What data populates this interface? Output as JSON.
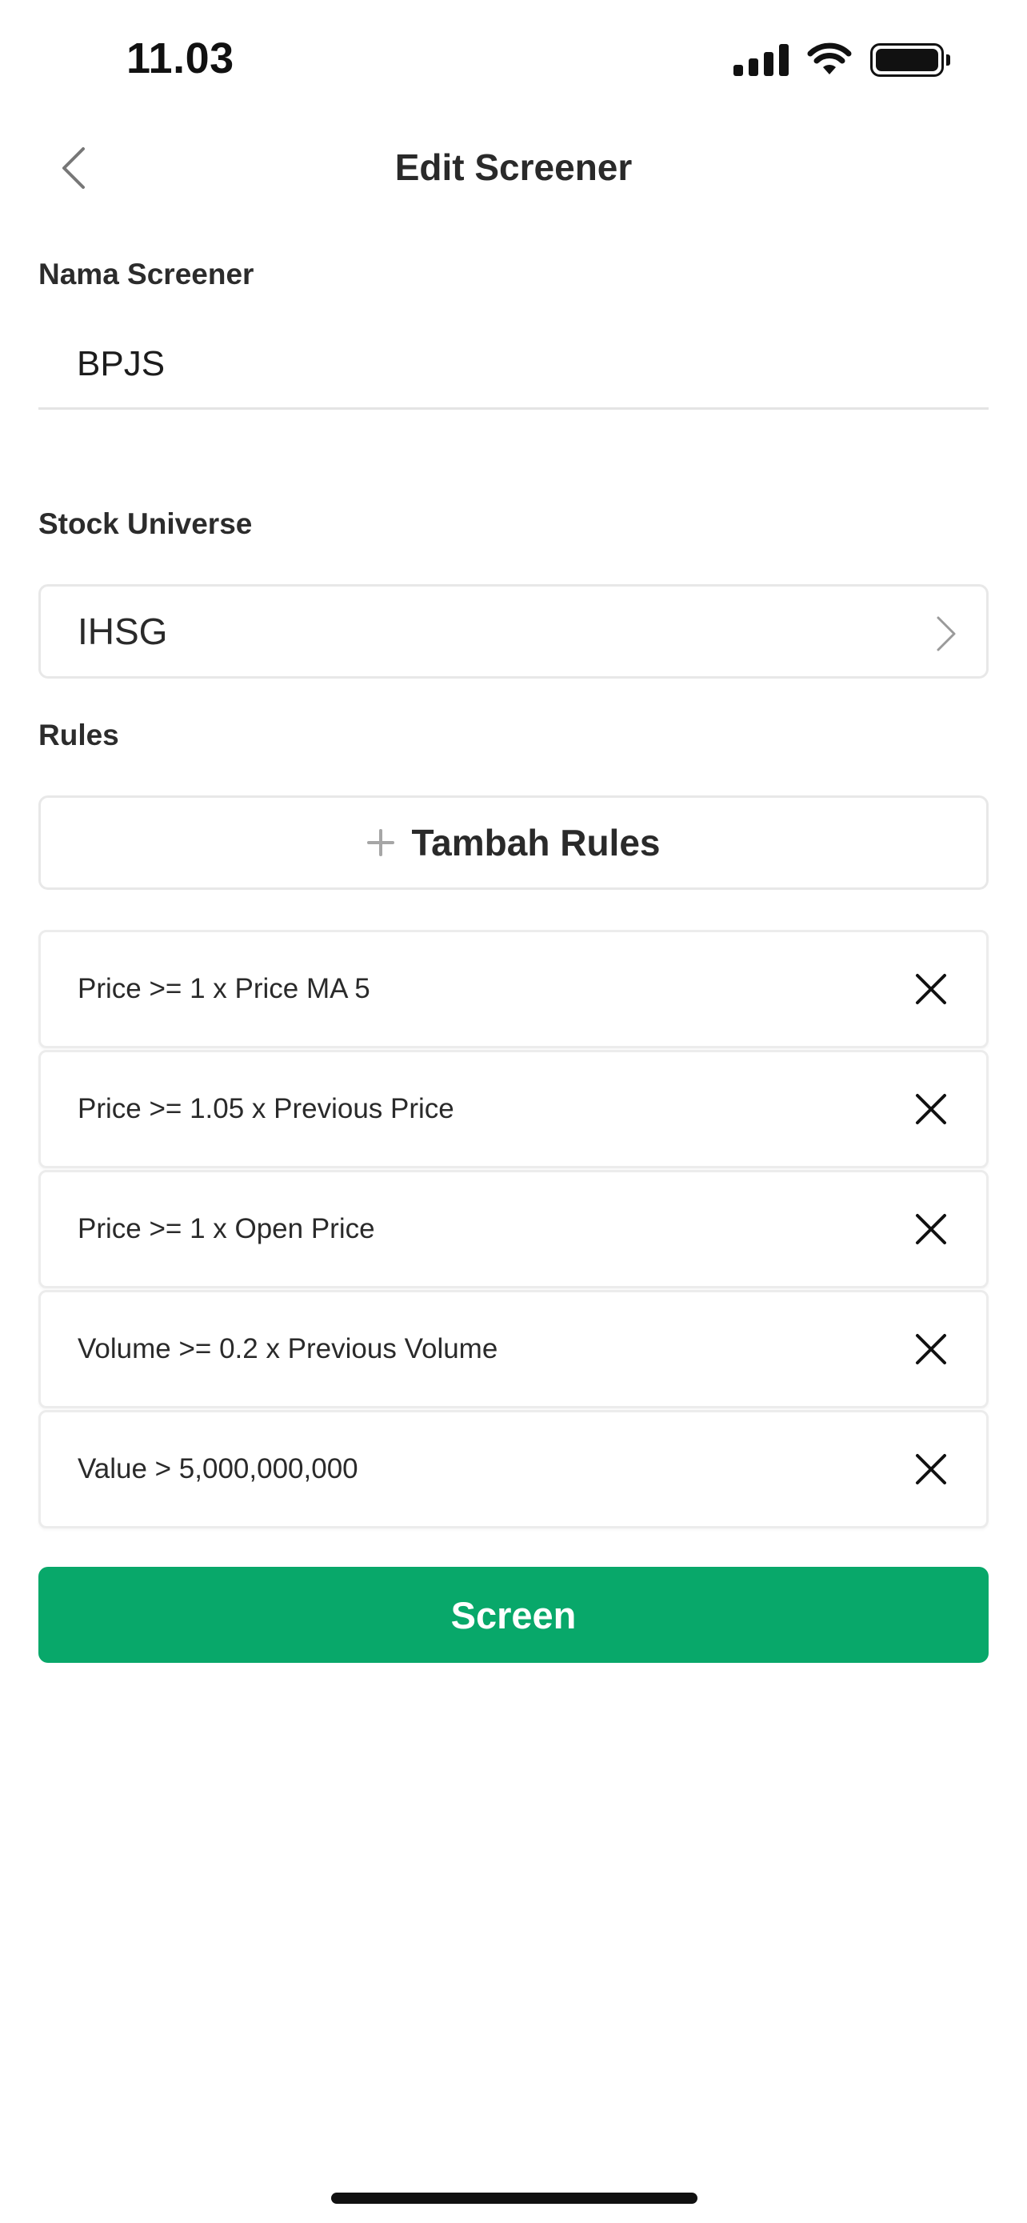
{
  "status_bar": {
    "time": "11.03",
    "icons": [
      "cellular-signal-icon",
      "wifi-icon",
      "battery-icon"
    ]
  },
  "nav": {
    "title": "Edit Screener",
    "back_icon": "chevron-left-icon"
  },
  "form": {
    "name_label": "Nama Screener",
    "name_value": "BPJS",
    "universe_label": "Stock Universe",
    "universe_value": "IHSG",
    "rules_label": "Rules",
    "add_rules_label": "Tambah Rules"
  },
  "rules": [
    "Price >= 1 x Price MA 5",
    "Price >= 1.05 x Previous Price",
    "Price >= 1 x Open Price",
    "Volume >= 0.2 x Previous Volume",
    "Value > 5,000,000,000"
  ],
  "actions": {
    "screen_label": "Screen"
  },
  "colors": {
    "primary": "#08a86a",
    "text": "#2a2a2a",
    "border": "#e8e8e8"
  }
}
